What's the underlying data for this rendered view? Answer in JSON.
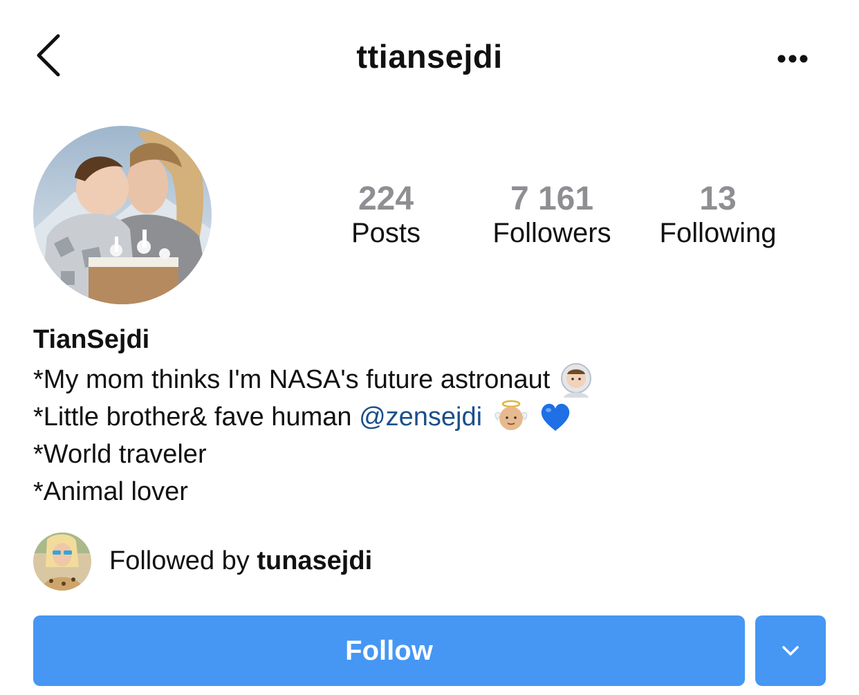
{
  "header": {
    "title": "ttiansejdi",
    "back_icon": "chevron-left-icon",
    "more_icon": "more-horizontal-icon"
  },
  "stats": {
    "posts": {
      "value": "224",
      "label": "Posts"
    },
    "followers": {
      "value": "7 161",
      "label": "Followers"
    },
    "following": {
      "value": "13",
      "label": "Following"
    }
  },
  "profile": {
    "display_name": "TianSejdi",
    "bio": {
      "line1": "*My mom thinks I'm NASA's future astronaut",
      "line2_prefix": "*Little brother& fave human ",
      "line2_mention": "@zensejdi",
      "line3": "*World traveler",
      "line4": "*Animal lover"
    },
    "bio_emojis": [
      "astronaut-emoji",
      "baby-angel-emoji",
      "blue-heart-emoji"
    ]
  },
  "followed_by": {
    "prefix": "Followed by ",
    "username": "tunasejdi"
  },
  "actions": {
    "follow_label": "Follow",
    "dropdown_icon": "chevron-down-icon"
  },
  "colors": {
    "accent": "#4597f3",
    "mention": "#1b4f8a",
    "stat_value": "#8e8e93"
  }
}
